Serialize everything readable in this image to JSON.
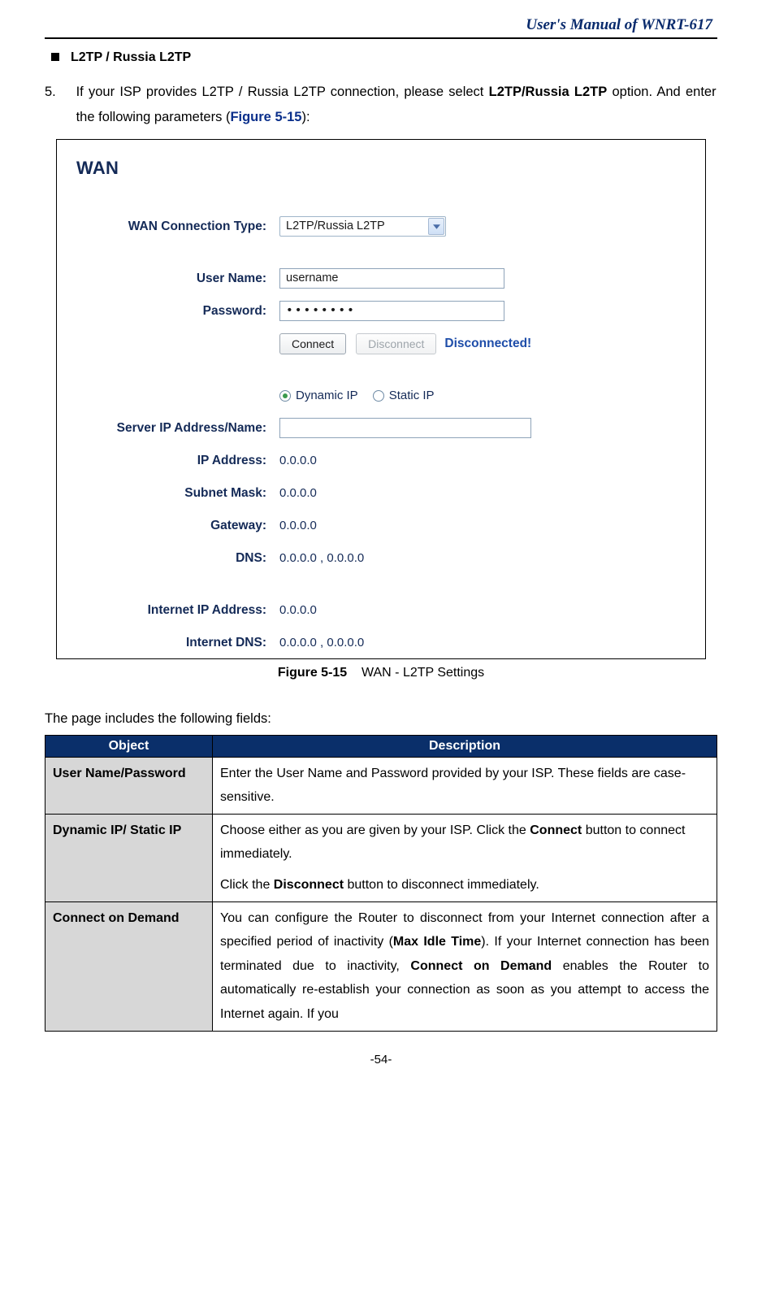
{
  "header": {
    "title": "User's Manual of WNRT-617"
  },
  "bullet": {
    "label": "L2TP / Russia L2TP"
  },
  "step": {
    "num": "5.",
    "text_pre": "If your ISP provides L2TP / Russia L2TP connection, please select ",
    "text_bold": "L2TP/Russia L2TP",
    "text_post1": " option. And enter the following parameters (",
    "fig_ref": "Figure 5-15",
    "text_post2": "):"
  },
  "figure": {
    "title": "WAN",
    "rows": {
      "conn_type_label": "WAN Connection Type:",
      "conn_type_value": "L2TP/Russia L2TP",
      "user_label": "User Name:",
      "user_value": "username",
      "pwd_label": "Password:",
      "pwd_value": "••••••••",
      "btn_connect": "Connect",
      "btn_disconnect": "Disconnect",
      "status": "Disconnected!",
      "radio_dynamic": "Dynamic IP",
      "radio_static": "Static IP",
      "server_label": "Server IP Address/Name:",
      "server_value": "",
      "ip_label": "IP Address:",
      "ip_value": "0.0.0.0",
      "mask_label": "Subnet Mask:",
      "mask_value": "0.0.0.0",
      "gw_label": "Gateway:",
      "gw_value": "0.0.0.0",
      "dns_label": "DNS:",
      "dns_value": "0.0.0.0 , 0.0.0.0",
      "iip_label": "Internet IP Address:",
      "iip_value": "0.0.0.0",
      "idns_label": "Internet DNS:",
      "idns_value": "0.0.0.0 , 0.0.0.0"
    },
    "caption_bold": "Figure 5-15",
    "caption_rest": "    WAN - L2TP Settings"
  },
  "intro": "The page includes the following fields:",
  "table": {
    "head_obj": "Object",
    "head_desc": "Description",
    "rows": [
      {
        "obj": "User Name/Password",
        "desc_plain": "Enter the User Name and Password provided by your ISP. These fields are case-sensitive."
      },
      {
        "obj": "Dynamic IP/ Static IP",
        "desc_p1_pre": "Choose either as you are given by your ISP. Click the ",
        "desc_p1_b": "Connect",
        "desc_p1_post": " button to connect immediately.",
        "desc_p2_pre": "Click the ",
        "desc_p2_b": "Disconnect",
        "desc_p2_post": " button to disconnect immediately."
      },
      {
        "obj": "Connect on Demand",
        "desc_pre": "You can configure the Router to disconnect from your Internet connection after a specified period of inactivity (",
        "desc_b1": "Max Idle Time",
        "desc_mid1": "). If your Internet connection has been terminated due to inactivity, ",
        "desc_b2": "Connect on Demand",
        "desc_post": " enables the Router to automatically re-establish your connection as soon as you attempt to access the Internet again. If you"
      }
    ]
  },
  "page_number": "-54-"
}
